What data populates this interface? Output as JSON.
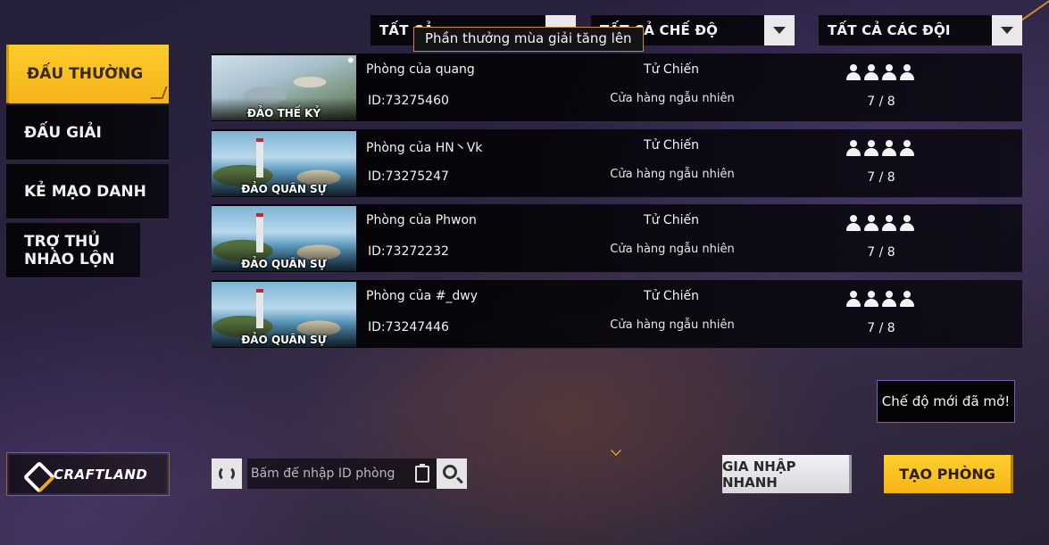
{
  "filters": [
    {
      "label": "TẤT CẢ"
    },
    {
      "label": "TẤT CẢ CHẾ ĐỘ"
    },
    {
      "label": "TẤT CẢ CÁC ĐỘI"
    }
  ],
  "tooltip": "Phần thưởng mùa giải tăng lên",
  "sidebar": {
    "items": [
      {
        "label": "ĐẤU THƯỜNG",
        "active": true
      },
      {
        "label": "ĐẤU GIẢI"
      },
      {
        "label": "KẺ MẠO DANH"
      },
      {
        "label": "TRỢ THỦ NHÀO LỘN"
      }
    ]
  },
  "rooms": [
    {
      "map": "ĐẢO THẾ KỶ",
      "name": "Phòng của quang",
      "id": "ID:73275460",
      "mode": "Tử Chiến",
      "shop": "Cửa hàng ngẫu nhiên",
      "players": "7 / 8"
    },
    {
      "map": "ĐẢO QUÂN SỰ",
      "name": "Phòng của HN丶Vk",
      "id": "ID:73275247",
      "mode": "Tử Chiến",
      "shop": "Cửa hàng ngẫu nhiên",
      "players": "7 / 8"
    },
    {
      "map": "ĐẢO QUÂN SỰ",
      "name": "Phòng của Phwon",
      "id": "ID:73272232",
      "mode": "Tử Chiến",
      "shop": "Cửa hàng ngẫu nhiên",
      "players": "7 / 8"
    },
    {
      "map": "ĐẢO QUÂN SỰ",
      "name": "Phòng của #_dwy",
      "id": "ID:73247446",
      "mode": "Tử Chiến",
      "shop": "Cửa hàng ngẫu nhiên",
      "players": "7 / 8"
    }
  ],
  "notice": "Chế độ mới đã mở!",
  "craftland": "CRAFTLAND",
  "search": {
    "placeholder": "Bấm để nhập ID phòng"
  },
  "buttons": {
    "quick_join": "GIA NHẬP NHANH",
    "create_room": "TẠO PHÒNG"
  },
  "colors": {
    "accent": "#f5b416",
    "panel": "#000000",
    "background": "#2b2340"
  }
}
